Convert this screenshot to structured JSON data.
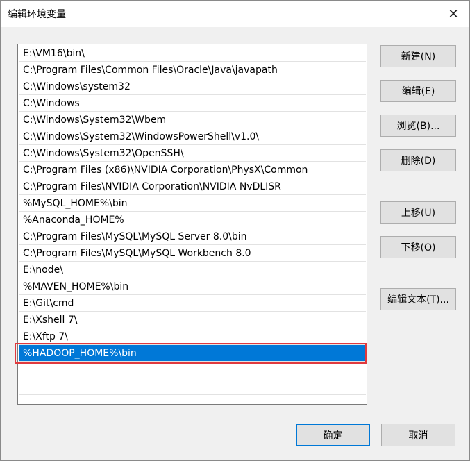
{
  "window": {
    "title": "编辑环境变量",
    "close_glyph": "✕"
  },
  "path_list": {
    "items": [
      "E:\\VM16\\bin\\",
      "C:\\Program Files\\Common Files\\Oracle\\Java\\javapath",
      "C:\\Windows\\system32",
      "C:\\Windows",
      "C:\\Windows\\System32\\Wbem",
      "C:\\Windows\\System32\\WindowsPowerShell\\v1.0\\",
      "C:\\Windows\\System32\\OpenSSH\\",
      "C:\\Program Files (x86)\\NVIDIA Corporation\\PhysX\\Common",
      "C:\\Program Files\\NVIDIA Corporation\\NVIDIA NvDLISR",
      "%MySQL_HOME%\\bin",
      "%Anaconda_HOME%",
      "C:\\Program Files\\MySQL\\MySQL Server 8.0\\bin",
      "C:\\Program Files\\MySQL\\MySQL Workbench 8.0",
      "E:\\node\\",
      "%MAVEN_HOME%\\bin",
      "E:\\Git\\cmd",
      "E:\\Xshell 7\\",
      "E:\\Xftp 7\\",
      "%HADOOP_HOME%\\bin"
    ],
    "selected_index": 18,
    "selection_color": "#0078d7",
    "annotation_color": "#e0393e"
  },
  "buttons": {
    "new": "新建(N)",
    "edit": "编辑(E)",
    "browse": "浏览(B)...",
    "delete": "删除(D)",
    "move_up": "上移(U)",
    "move_down": "下移(O)",
    "edit_text": "编辑文本(T)...",
    "ok": "确定",
    "cancel": "取消"
  }
}
